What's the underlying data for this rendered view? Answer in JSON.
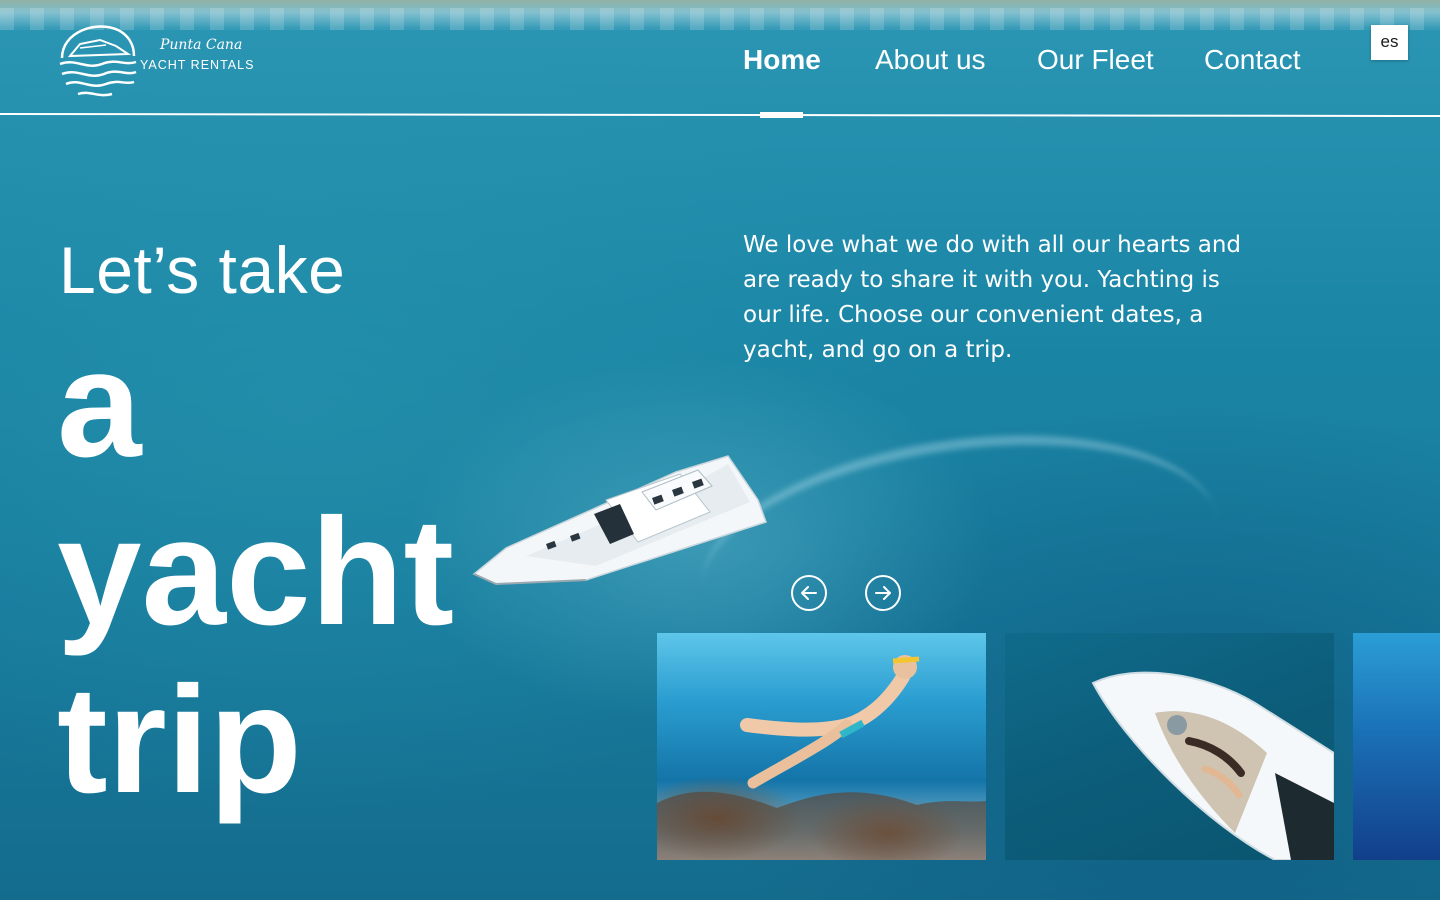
{
  "brand": {
    "script": "Punta Cana",
    "name": "YACHT RENTALS"
  },
  "nav": {
    "items": [
      {
        "label": "Home",
        "active": true
      },
      {
        "label": "About us",
        "active": false
      },
      {
        "label": "Our Fleet",
        "active": false
      },
      {
        "label": "Contact",
        "active": false
      }
    ]
  },
  "language": {
    "label": "es"
  },
  "hero": {
    "intro": "Let’s take",
    "line1": "a yacht",
    "line2": "trip",
    "description": "We love what we do with all our hearts and are ready to share it with you. Yachting is our life. Choose our convenient dates, a yacht, and go on a trip."
  },
  "carousel": {
    "prev_icon": "arrow-left-icon",
    "next_icon": "arrow-right-icon",
    "cards": [
      "snorkeling-photo",
      "yacht-deck-photo",
      "underwater-photo"
    ]
  },
  "colors": {
    "sea": "#1a7f9e",
    "text": "#ffffff",
    "lang_bg": "#ffffff"
  }
}
